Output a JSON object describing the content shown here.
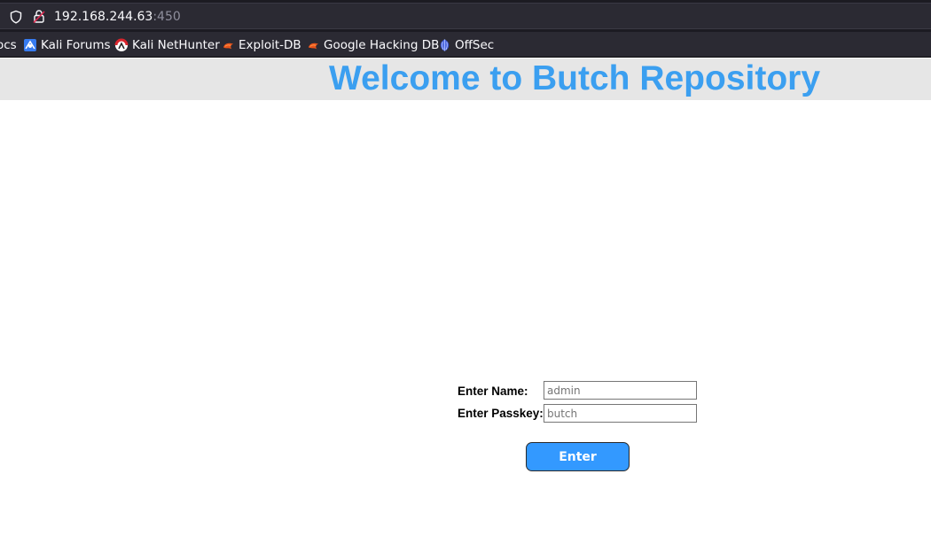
{
  "browser": {
    "url_host": "192.168.244.63",
    "url_port": ":450",
    "bookmarks": [
      {
        "label": "ocs",
        "icon": "none"
      },
      {
        "label": "Kali Forums",
        "icon": "kali-forums-icon"
      },
      {
        "label": "Kali NetHunter",
        "icon": "kali-nethunter-icon"
      },
      {
        "label": "Exploit-DB",
        "icon": "exploit-db-icon"
      },
      {
        "label": "Google Hacking DB",
        "icon": "exploit-db-icon"
      },
      {
        "label": "OffSec",
        "icon": "offsec-icon"
      }
    ]
  },
  "page": {
    "title": "Welcome to Butch Repository",
    "form": {
      "name_label": "Enter Name:",
      "name_placeholder": "admin",
      "passkey_label": "Enter Passkey:",
      "passkey_placeholder": "butch",
      "submit_label": "Enter"
    }
  },
  "colors": {
    "title": "#3b9ff0",
    "banner_bg": "#e6e6e6",
    "button_bg": "#3399ff",
    "chrome_bg": "#2b2a33"
  }
}
